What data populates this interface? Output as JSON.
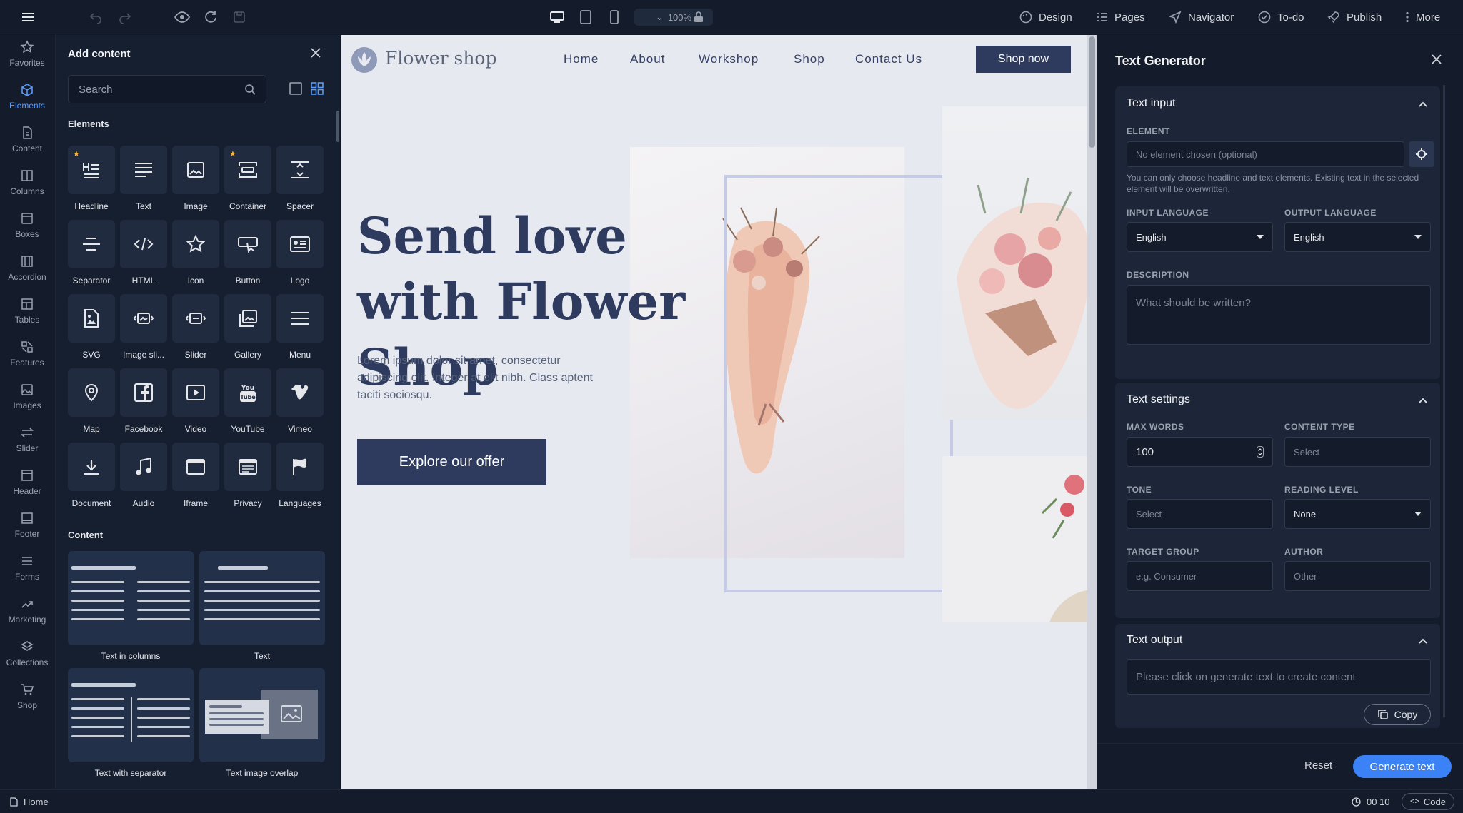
{
  "topbar": {
    "zoom": "100%",
    "nav": [
      {
        "label": "Design",
        "icon": "palette-icon"
      },
      {
        "label": "Pages",
        "icon": "list-icon"
      },
      {
        "label": "Navigator",
        "icon": "navigation-arrow-icon"
      },
      {
        "label": "To-do",
        "icon": "check-circle-icon"
      },
      {
        "label": "Publish",
        "icon": "rocket-icon"
      },
      {
        "label": "More",
        "icon": "dots-vertical-icon"
      }
    ]
  },
  "rail": [
    {
      "label": "Favorites"
    },
    {
      "label": "Elements"
    },
    {
      "label": "Content"
    },
    {
      "label": "Columns"
    },
    {
      "label": "Boxes"
    },
    {
      "label": "Accordion"
    },
    {
      "label": "Tables"
    },
    {
      "label": "Features"
    },
    {
      "label": "Images"
    },
    {
      "label": "Slider"
    },
    {
      "label": "Header"
    },
    {
      "label": "Footer"
    },
    {
      "label": "Forms"
    },
    {
      "label": "Marketing"
    },
    {
      "label": "Collections"
    },
    {
      "label": "Shop"
    }
  ],
  "add_panel": {
    "title": "Add content",
    "search_placeholder": "Search",
    "elements_heading": "Elements",
    "content_heading": "Content",
    "elements": [
      {
        "label": "Headline"
      },
      {
        "label": "Text"
      },
      {
        "label": "Image"
      },
      {
        "label": "Container"
      },
      {
        "label": "Spacer"
      },
      {
        "label": "Separator"
      },
      {
        "label": "HTML"
      },
      {
        "label": "Icon"
      },
      {
        "label": "Button"
      },
      {
        "label": "Logo"
      },
      {
        "label": "SVG"
      },
      {
        "label": "Image sli..."
      },
      {
        "label": "Slider"
      },
      {
        "label": "Gallery"
      },
      {
        "label": "Menu"
      },
      {
        "label": "Map"
      },
      {
        "label": "Facebook"
      },
      {
        "label": "Video"
      },
      {
        "label": "YouTube"
      },
      {
        "label": "Vimeo"
      },
      {
        "label": "Document"
      },
      {
        "label": "Audio"
      },
      {
        "label": "Iframe"
      },
      {
        "label": "Privacy"
      },
      {
        "label": "Languages"
      }
    ],
    "templates": [
      {
        "label": "Text in columns"
      },
      {
        "label": "Text"
      },
      {
        "label": "Text with separator"
      },
      {
        "label": "Text image overlap"
      }
    ]
  },
  "site": {
    "brand": "Flower shop",
    "nav": [
      "Home",
      "About",
      "Workshop",
      "Shop",
      "Contact Us"
    ],
    "shop_now": "Shop now",
    "hero_title": "Send love with Flower Shop",
    "hero_body": "Lorem ipsum dolor sit amet, consectetur adipiscing elit. Integer at elit nibh. Class aptent taciti sociosqu.",
    "cta": "Explore our offer"
  },
  "generator": {
    "title": "Text Generator",
    "text_input": {
      "heading": "Text input",
      "element_label": "ELEMENT",
      "element_placeholder": "No element chosen (optional)",
      "hint": "You can only choose headline and text elements. Existing text in the selected element will be overwritten.",
      "input_language_label": "INPUT LANGUAGE",
      "input_language": "English",
      "output_language_label": "OUTPUT LANGUAGE",
      "output_language": "English",
      "description_label": "DESCRIPTION",
      "description_placeholder": "What should be written?"
    },
    "text_settings": {
      "heading": "Text settings",
      "max_words_label": "MAX WORDS",
      "max_words": "100",
      "content_type_label": "CONTENT TYPE",
      "content_type": "Select",
      "tone_label": "TONE",
      "tone": "Select",
      "reading_level_label": "READING LEVEL",
      "reading_level": "None",
      "target_group_label": "TARGET GROUP",
      "target_group_placeholder": "e.g. Consumer",
      "author_label": "AUTHOR",
      "author_placeholder": "Other"
    },
    "text_output": {
      "heading": "Text output",
      "placeholder": "Please click on generate text to create content",
      "copy": "Copy"
    },
    "reset": "Reset",
    "generate": "Generate text"
  },
  "status": {
    "page": "Home",
    "timer": "00 10",
    "code": "Code"
  }
}
